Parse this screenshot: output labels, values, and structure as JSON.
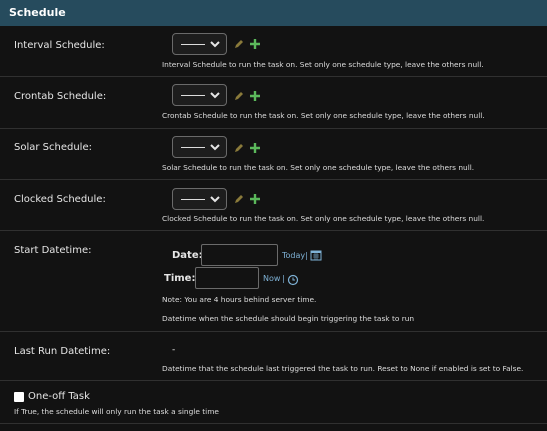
{
  "section": {
    "title": "Schedule"
  },
  "interval": {
    "label": "Interval Schedule:",
    "value": "---------",
    "help": "Interval Schedule to run the task on. Set only one schedule type, leave the others null."
  },
  "crontab": {
    "label": "Crontab Schedule:",
    "value": "---------",
    "help": "Crontab Schedule to run the task on. Set only one schedule type, leave the others null."
  },
  "solar": {
    "label": "Solar Schedule:",
    "value": "---------",
    "help": "Solar Schedule to run the task on. Set only one schedule type, leave the others null."
  },
  "clocked": {
    "label": "Clocked Schedule:",
    "value": "---------",
    "help": "Clocked Schedule to run the task on. Set only one schedule type, leave the others null."
  },
  "start_datetime": {
    "label": "Start Datetime:",
    "date_label": "Date:",
    "date_value": "",
    "today_link": "Today",
    "separator": "|",
    "time_label": "Time:",
    "time_value": "",
    "now_link": "Now",
    "timezone_note": "Note: You are 4 hours behind server time.",
    "help": "Datetime when the schedule should begin triggering the task to run"
  },
  "last_run": {
    "label": "Last Run Datetime:",
    "value": "-",
    "help": "Datetime that the schedule last triggered the task to run. Reset to None if enabled is set to False."
  },
  "one_off": {
    "label": "One-off Task",
    "checked": false,
    "help": "If True, the schedule will only run the task a single time"
  },
  "colors": {
    "header_bg": "#264b5d",
    "link": "#7fb2d6",
    "add_icon": "#5bb85b",
    "edit_icon": "#8a7a3a"
  }
}
